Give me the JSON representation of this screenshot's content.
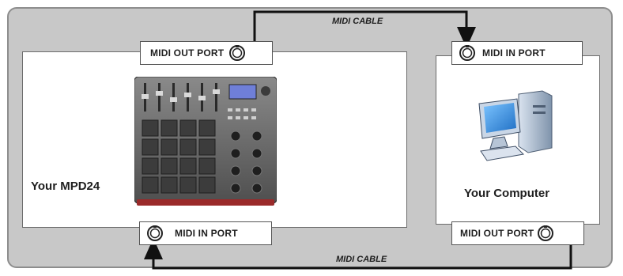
{
  "cables": {
    "top_label": "MIDI CABLE",
    "bottom_label": "MIDI CABLE"
  },
  "mpd": {
    "name": "Your MPD24",
    "out_port": "MIDI OUT PORT",
    "in_port": "MIDI IN PORT"
  },
  "computer": {
    "name": "Your Computer",
    "in_port": "MIDI IN PORT",
    "out_port": "MIDI OUT PORT"
  },
  "colors": {
    "background": "#c8c8c8",
    "cable": "#111111",
    "device_body": "#6a6a6a",
    "pad": "#3c3c3c",
    "screen": "#6f7fd8",
    "monitor_screen": "#2d86d8"
  }
}
